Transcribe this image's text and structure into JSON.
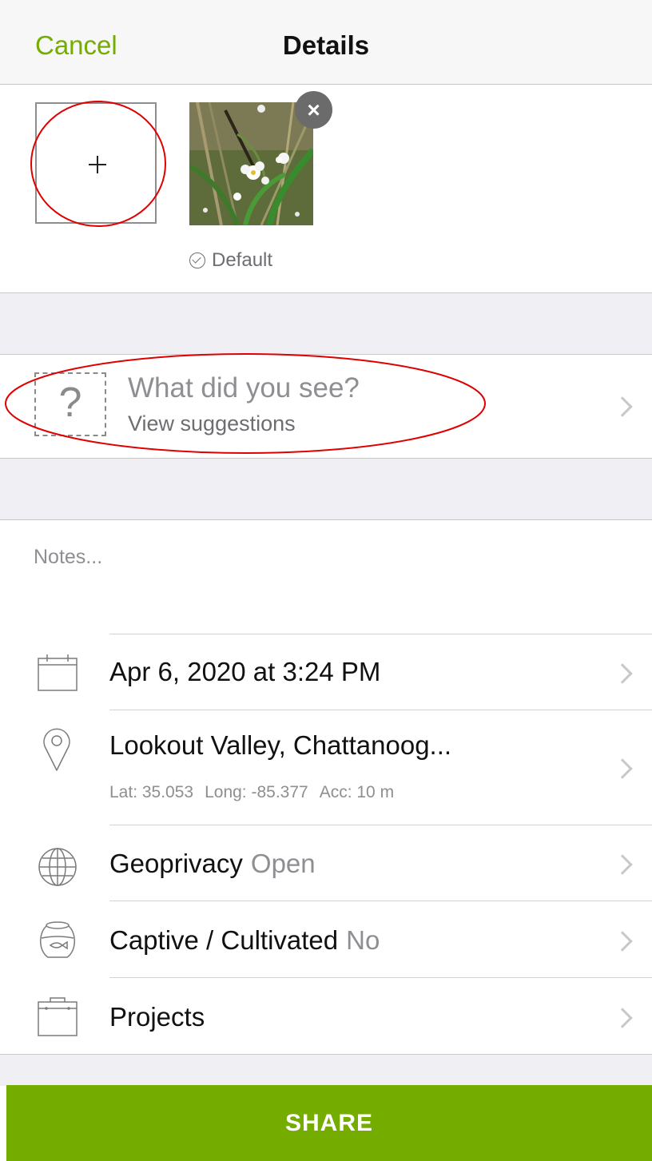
{
  "nav": {
    "cancel_label": "Cancel",
    "title": "Details"
  },
  "photos": {
    "add_symbol": "+",
    "remove_symbol": "×",
    "default_label": "Default"
  },
  "species": {
    "placeholder": "What did you see?",
    "suggestions_label": "View suggestions",
    "icon_symbol": "?"
  },
  "notes": {
    "placeholder": "Notes..."
  },
  "rows": {
    "date": {
      "label": "Apr 6, 2020 at 3:24 PM",
      "icon": "calendar-icon"
    },
    "location": {
      "label": "Lookout Valley, Chattanoog...",
      "lat": "Lat: 35.053",
      "long": "Long: -85.377",
      "acc": "Acc: 10 m",
      "icon": "map-pin-icon"
    },
    "geoprivacy": {
      "label": "Geoprivacy",
      "value": "Open",
      "icon": "globe-icon"
    },
    "captive": {
      "label": "Captive / Cultivated",
      "value": "No",
      "icon": "fishbowl-icon"
    },
    "projects": {
      "label": "Projects",
      "icon": "briefcase-icon"
    }
  },
  "share": {
    "label": "SHARE"
  },
  "colors": {
    "accent": "#74ac00",
    "annotation": "#e00000",
    "band": "#efeff4"
  }
}
